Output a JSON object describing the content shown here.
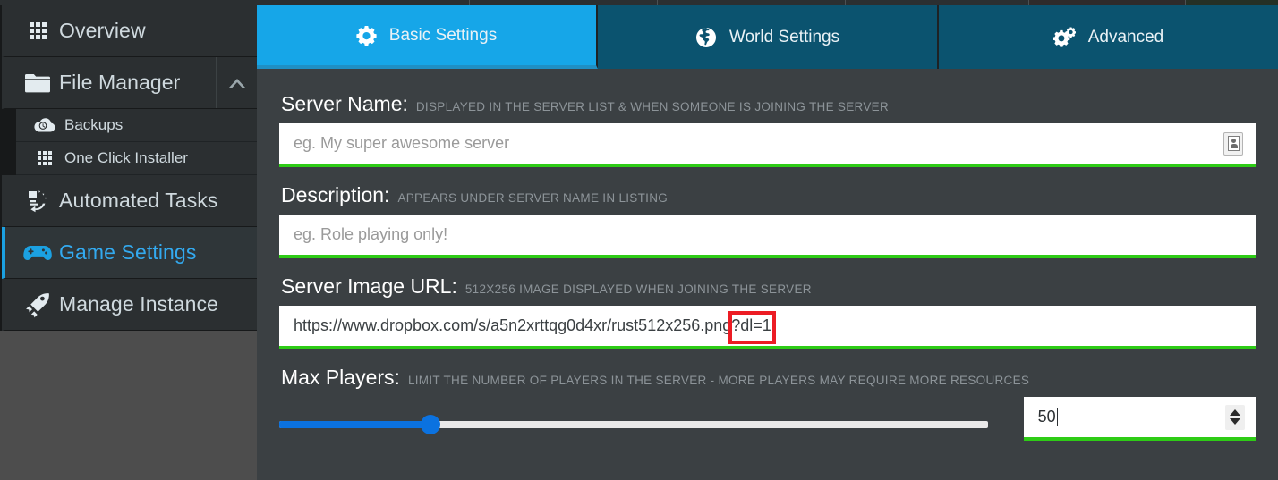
{
  "colors": {
    "accent_blue": "#16a6e8",
    "tab_inactive": "#0b536f",
    "sidebar_bg": "#4d4d4d",
    "nav_item_bg": "#2b2f31",
    "content_bg": "#3b4043",
    "underline_green": "#2ecc16",
    "slider_blue": "#0b72e0",
    "highlight_red": "#ec1c24"
  },
  "sidebar": {
    "items": [
      {
        "label": "Overview",
        "icon": "grid-icon",
        "active": false,
        "expandable": false
      },
      {
        "label": "File Manager",
        "icon": "folder-icon",
        "active": false,
        "expandable": true,
        "chevron": "chevron-up-icon"
      },
      {
        "label": "Automated Tasks",
        "icon": "automated-tasks-icon",
        "active": false,
        "expandable": false
      },
      {
        "label": "Game Settings",
        "icon": "gamepad-icon",
        "active": true,
        "expandable": false
      },
      {
        "label": "Manage Instance",
        "icon": "rocket-icon",
        "active": false,
        "expandable": false
      }
    ],
    "sub_items": [
      {
        "label": "Backups",
        "icon": "cloud-clock-icon",
        "parent": "File Manager"
      },
      {
        "label": "One Click Installer",
        "icon": "grid-icon",
        "parent": "File Manager"
      }
    ]
  },
  "tabs": [
    {
      "label": "Basic Settings",
      "icon": "gear-icon",
      "active": true
    },
    {
      "label": "World Settings",
      "icon": "globe-icon",
      "active": false
    },
    {
      "label": "Advanced",
      "icon": "gears-icon",
      "active": false
    }
  ],
  "form": {
    "server_name": {
      "label": "Server Name:",
      "hint": "DISPLAYED IN THE SERVER LIST & WHEN SOMEONE IS JOINING THE SERVER",
      "value": "",
      "placeholder": "eg. My super awesome server",
      "autofill_icon": "contact-card-icon"
    },
    "description": {
      "label": "Description:",
      "hint": "APPEARS UNDER SERVER NAME IN LISTING",
      "value": "",
      "placeholder": "eg. Role playing only!"
    },
    "server_image_url": {
      "label": "Server Image URL:",
      "hint": "512X256 IMAGE DISPLAYED WHEN JOINING THE SERVER",
      "value": "https://www.dropbox.com/s/a5n2xrttqg0d4xr/rust512x256.png?dl=1",
      "placeholder": "",
      "highlighted_fragment": "?dl=1"
    },
    "max_players": {
      "label": "Max Players:",
      "hint": "LIMIT THE NUMBER OF PLAYERS IN THE SERVER - MORE PLAYERS MAY REQUIRE MORE RESOURCES",
      "value": "50",
      "slider_percent": 21.3
    }
  }
}
